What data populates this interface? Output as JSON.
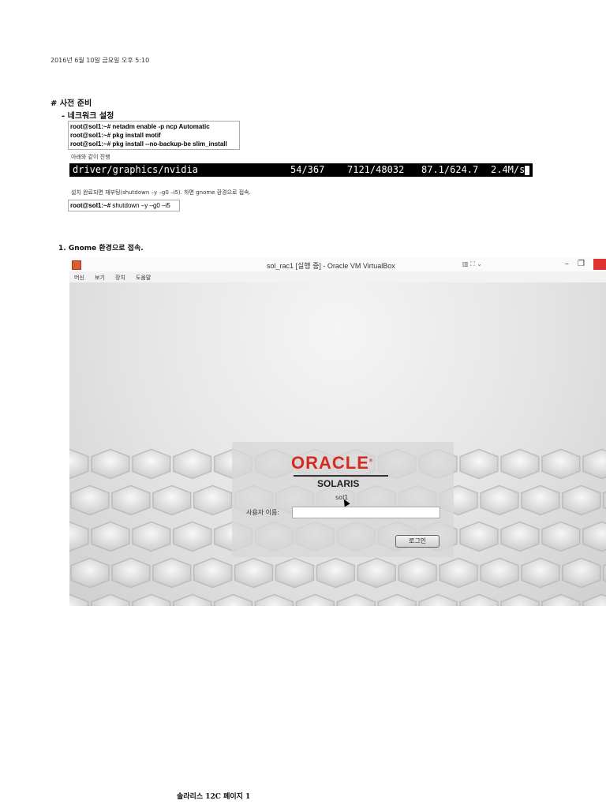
{
  "doc": {
    "date_line": "2016년 6월 10일 금요일      오후 5:10",
    "section_title": "# 사전 준비",
    "bullet_item": "-   네크워크 설정",
    "commands": [
      "root@sol1:~# netadm enable -p ncp Automatic",
      "root@sol1:~# pkg install motif",
      "root@sol1:~# pkg install --no-backup-be slim_install"
    ],
    "note_proceed": "아래와 같이 진행",
    "terminal": {
      "col1": "driver/graphics/nvidia",
      "col2": "54/367",
      "col3": "7121/48032",
      "col4": "87.1/624.7",
      "col5": "2.4M/s"
    },
    "note_reboot": "설치 완료되면 재부팅(shutdown –y –g0 –i5). 하면 gnome 환경으로 접속.",
    "shutdown_prompt": "root@sol1:~#",
    "shutdown_cmd": " shutdown –y –g0 –i5",
    "step1": "1.   Gnome 환경으로 접속.",
    "footer": "솔라리스 12C 페이지 1"
  },
  "vm_window": {
    "title": "sol_rac1 [실행 중] - Oracle VM VirtualBox",
    "menu": [
      "머신",
      "보기",
      "장치",
      "도움말"
    ],
    "toolbar_icons": "▥ ⛶ ⌄",
    "controls": {
      "minimize": "–",
      "restore": "❐"
    },
    "login": {
      "brand": "ORACLE",
      "brand_mark": "®",
      "product": "SOLARIS",
      "hostname": "sol1",
      "username_label": "사용자 이름:",
      "username_value": "",
      "login_button": "로그인"
    }
  },
  "colors": {
    "oracle_red": "#d52b1e",
    "terminal_bg": "#000000"
  }
}
